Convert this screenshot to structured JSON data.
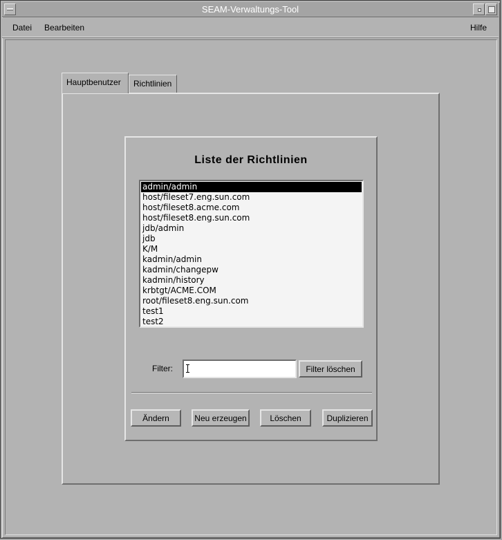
{
  "window": {
    "title": "SEAM-Verwaltungs-Tool"
  },
  "menubar": {
    "file": "Datei",
    "edit": "Bearbeiten",
    "help": "Hilfe"
  },
  "tabs": [
    {
      "label": "Hauptbenutzer",
      "active": true
    },
    {
      "label": "Richtlinien",
      "active": false
    }
  ],
  "dialog": {
    "title": "Liste der Richtlinien",
    "list": [
      {
        "label": "admin/admin",
        "selected": true
      },
      {
        "label": "host/fileset7.eng.sun.com",
        "selected": false
      },
      {
        "label": "host/fileset8.acme.com",
        "selected": false
      },
      {
        "label": "host/fileset8.eng.sun.com",
        "selected": false
      },
      {
        "label": "jdb/admin",
        "selected": false
      },
      {
        "label": "jdb",
        "selected": false
      },
      {
        "label": "K/M",
        "selected": false
      },
      {
        "label": "kadmin/admin",
        "selected": false
      },
      {
        "label": "kadmin/changepw",
        "selected": false
      },
      {
        "label": "kadmin/history",
        "selected": false
      },
      {
        "label": "krbtgt/ACME.COM",
        "selected": false
      },
      {
        "label": "root/fileset8.eng.sun.com",
        "selected": false
      },
      {
        "label": "test1",
        "selected": false
      },
      {
        "label": "test2",
        "selected": false
      }
    ],
    "filter_label": "Filter:",
    "filter_value": "",
    "filter_clear": "Filter löschen",
    "buttons": {
      "modify": "Ändern",
      "create": "Neu erzeugen",
      "delete": "Löschen",
      "duplicate": "Duplizieren"
    }
  }
}
